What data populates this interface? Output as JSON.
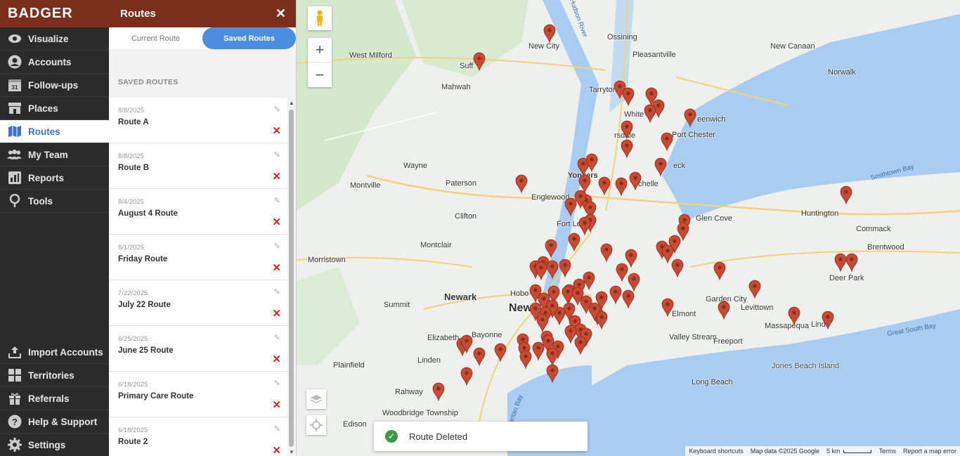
{
  "brand": {
    "logo_text": "BADGER"
  },
  "nav": {
    "top": [
      {
        "label": "Visualize",
        "icon": "eye-icon"
      },
      {
        "label": "Accounts",
        "icon": "person-icon"
      },
      {
        "label": "Follow-ups",
        "icon": "calendar-icon",
        "badge": "31"
      },
      {
        "label": "Places",
        "icon": "storefront-icon"
      },
      {
        "label": "Routes",
        "icon": "map-icon",
        "active": true
      },
      {
        "label": "My Team",
        "icon": "team-icon"
      },
      {
        "label": "Reports",
        "icon": "chart-icon"
      },
      {
        "label": "Tools",
        "icon": "pin-tool-icon"
      }
    ],
    "bottom": [
      {
        "label": "Import Accounts",
        "icon": "upload-icon"
      },
      {
        "label": "Territories",
        "icon": "grid-icon"
      },
      {
        "label": "Referrals",
        "icon": "gift-icon"
      },
      {
        "label": "Help & Support",
        "icon": "help-icon"
      },
      {
        "label": "Settings",
        "icon": "gear-icon"
      }
    ]
  },
  "panel": {
    "title": "Routes",
    "close_icon": "close-icon",
    "tabs": {
      "current": "Current Route",
      "saved": "Saved Routes"
    },
    "section_title": "SAVED ROUTES",
    "routes": [
      {
        "date": "8/8/2025",
        "name": "Route A"
      },
      {
        "date": "8/8/2025",
        "name": "Route B"
      },
      {
        "date": "8/4/2025",
        "name": "August 4 Route"
      },
      {
        "date": "8/1/2025",
        "name": "Friday Route"
      },
      {
        "date": "7/22/2025",
        "name": "July 22 Route"
      },
      {
        "date": "6/25/2025",
        "name": "June 25 Route"
      },
      {
        "date": "6/18/2025",
        "name": "Primary Care Route"
      },
      {
        "date": "6/18/2025",
        "name": "Route 2"
      }
    ]
  },
  "map": {
    "labels": {
      "new_city": "New City",
      "ossining": "Ossining",
      "new_canaan": "New Canaan",
      "west_milford": "West Milford",
      "pleasantville": "Pleasantville",
      "suffern": "Suff",
      "mahwah": "Mahwah",
      "tarrytown": "Tarryton",
      "white_plains": "White",
      "norwalk": "Norwalk",
      "greenwich": "eenwich",
      "port_chester": "Port Chester",
      "wayne": "Wayne",
      "yonkers": "Yonkers",
      "scarsdale": "rsdale",
      "montville": "Montville",
      "paterson": "Paterson",
      "englewood": "Englewood",
      "mamaroneck": "eck",
      "new_rochelle": "chelle",
      "huntington": "Huntington",
      "fort_lee": "Fort Lee",
      "clifton": "Clifton",
      "glen_cove": "Glen Cove",
      "commack": "Commack",
      "montclair": "Montclair",
      "morristown": "Morristown",
      "brentwood": "Brentwood",
      "deer_park": "Deer Park",
      "newark": "Newark",
      "new_york": "New York",
      "garden_city": "Garden City",
      "levittown": "Levittown",
      "summit": "Summit",
      "hoboken": "Hobo",
      "elmont": "Elmont",
      "massapequa": "Massapequa",
      "lindenhurst": "Linde",
      "elizabeth": "Elizabeth",
      "bayonne": "Bayonne",
      "valley_stream": "Valley Stream",
      "freeport": "Freeport",
      "plainfield": "Plainfield",
      "linden": "Linden",
      "rahway": "Rahway",
      "jones_beach": "Jones Beach Island",
      "woodbridge": "Woodbridge Township",
      "long_beach": "Long Beach",
      "edison": "Edison",
      "hudson_river": "Hudson River",
      "smithtown_bay": "Smithtown Bay",
      "great_south_bay": "Great South Bay",
      "raritan": "Raritan Bay"
    },
    "controls": {
      "pegman": "streetview-pegman-icon",
      "zoom_in": "+",
      "zoom_out": "−"
    },
    "toast": {
      "message": "Route Deleted"
    },
    "attribution": {
      "shortcuts": "Keyboard shortcuts",
      "data": "Map data ©2025 Google",
      "scale": "5 km",
      "terms": "Terms",
      "report": "Report a map error"
    },
    "pin_color": "#c84a32"
  }
}
